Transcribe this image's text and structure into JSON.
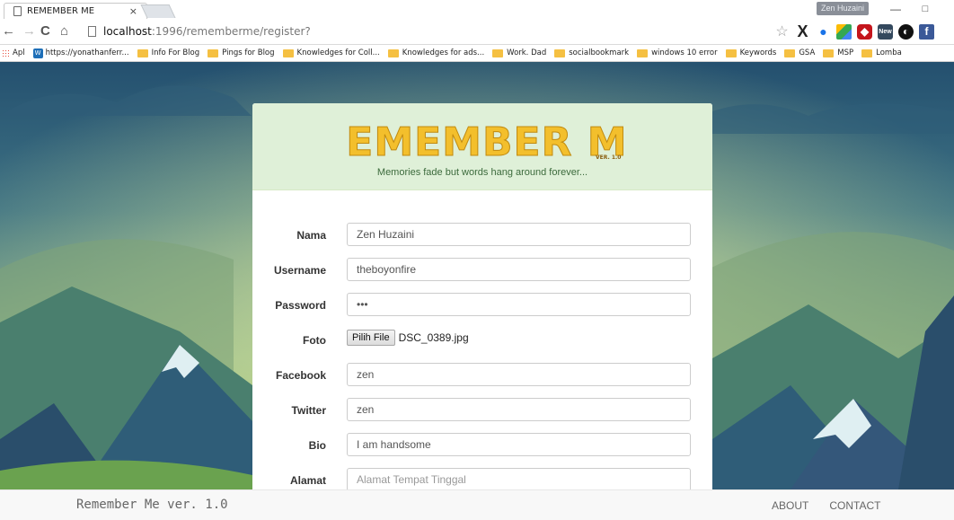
{
  "browser": {
    "tab_title": "REMEMBER ME",
    "tab_close": "×",
    "window_user": "Zen Huzaini",
    "min_glyph": "—",
    "max_glyph": "□",
    "url_host": "localhost",
    "url_rest": ":1996/rememberme/register?",
    "nav": {
      "back": "←",
      "forward": "→",
      "reload": "C",
      "home": "⌂"
    },
    "extensions": [
      "star-icon",
      "x-icon",
      "person-icon",
      "drive-icon",
      "ublock-icon",
      "new-icon",
      "dark-circle-icon",
      "facebook-icon"
    ]
  },
  "bookmarks": [
    {
      "label": "Apl",
      "icon": "apps-icon"
    },
    {
      "label": "https://yonathanferr...",
      "icon": "site-icon"
    },
    {
      "label": "Info For Blog",
      "icon": "folder-icon"
    },
    {
      "label": "Pings for Blog",
      "icon": "folder-icon"
    },
    {
      "label": "Knowledges for Coll...",
      "icon": "folder-icon"
    },
    {
      "label": "Knowledges for ads...",
      "icon": "folder-icon"
    },
    {
      "label": "Work. Dad",
      "icon": "folder-icon"
    },
    {
      "label": "socialbookmark",
      "icon": "folder-icon"
    },
    {
      "label": "windows 10 error",
      "icon": "folder-icon"
    },
    {
      "label": "Keywords",
      "icon": "folder-icon"
    },
    {
      "label": "GSA",
      "icon": "folder-icon"
    },
    {
      "label": "MSP",
      "icon": "folder-icon"
    },
    {
      "label": "Lomba",
      "icon": "folder-icon"
    }
  ],
  "header": {
    "logo_text": "REMEMBER ME",
    "logo_ver": "VER. 1.0",
    "tagline": "Memories fade but words hang around forever..."
  },
  "form": {
    "nama": {
      "label": "Nama",
      "value": "Zen Huzaini"
    },
    "username": {
      "label": "Username",
      "value": "theboyonfire"
    },
    "password": {
      "label": "Password",
      "value": "abc"
    },
    "foto": {
      "label": "Foto",
      "button": "Pilih File",
      "filename": "DSC_0389.jpg"
    },
    "facebook": {
      "label": "Facebook",
      "value": "zen"
    },
    "twitter": {
      "label": "Twitter",
      "value": "zen"
    },
    "bio": {
      "label": "Bio",
      "value": "I am handsome"
    },
    "alamat": {
      "label": "Alamat",
      "value": "",
      "placeholder": "Alamat Tempat Tinggal"
    }
  },
  "footer": {
    "brand": "Remember Me ver. 1.0",
    "links": [
      "ABOUT",
      "CONTACT"
    ]
  },
  "colors": {
    "header_bg": "#dff0d8",
    "logo_yellow": "#f3bf2c",
    "tagline_green": "#3c6a3c",
    "sky_top": "#2a5474",
    "meadow": "#b7d07a"
  }
}
